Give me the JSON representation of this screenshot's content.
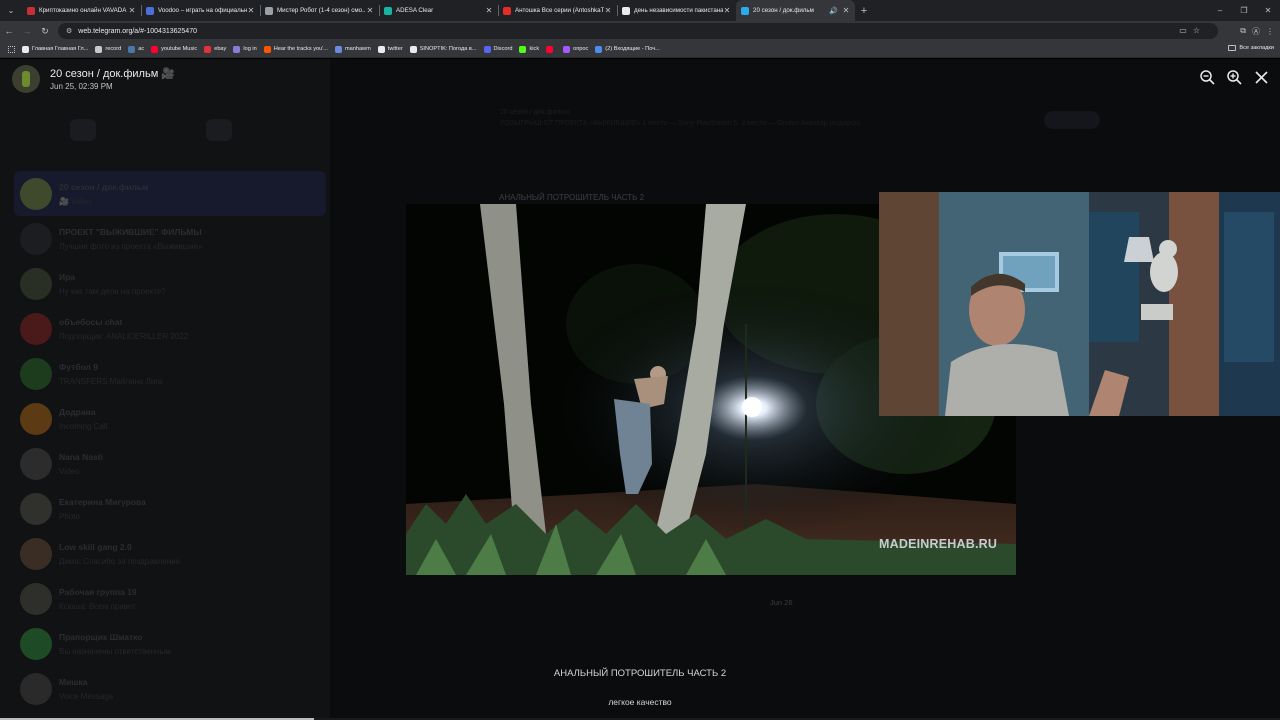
{
  "browser": {
    "tabs": [
      {
        "title": "Криптоказино онлайн VAVADA",
        "favicon_color": "#c62f3a",
        "active": false
      },
      {
        "title": "Voodoo – играть на официальн...",
        "favicon_color": "#4a6fd6",
        "active": false
      },
      {
        "title": "Мистер Робот (1-4 сезон) смо...",
        "favicon_color": "#9aa0a6",
        "active": false
      },
      {
        "title": "ADESA Clear",
        "favicon_color": "#17b3a3",
        "active": false
      },
      {
        "title": "Антошка Все серии (AntoshkaTV)",
        "favicon_color": "#e52d27",
        "active": false
      },
      {
        "title": "день независимости пакистана",
        "favicon_color": "#e8eaed",
        "active": false
      },
      {
        "title": "20 сезон / док.фильм",
        "favicon_color": "#2aabee",
        "active": true
      }
    ],
    "url": "web.telegram.org/a/#-1004313625470",
    "bookmarks": [
      {
        "label": "Главная Главная Гл...",
        "color": "#e8eaed"
      },
      {
        "label": "record",
        "color": "#c9c9c9"
      },
      {
        "label": "ac",
        "color": "#4a76a8"
      },
      {
        "label": "youtube Music",
        "color": "#ff0033"
      },
      {
        "label": "ebay",
        "color": "#e53238"
      },
      {
        "label": "log in",
        "color": "#8a7bd6"
      },
      {
        "label": "Hear the tracks you'...",
        "color": "#ff5500"
      },
      {
        "label": "manhawm",
        "color": "#6a8be0"
      },
      {
        "label": "twitter",
        "color": "#e8eaed"
      },
      {
        "label": "SINOPTIK: Погода в...",
        "color": "#e8eaed"
      },
      {
        "label": "Discord",
        "color": "#5865f2"
      },
      {
        "label": "kick",
        "color": "#53fc18"
      },
      {
        "label": "",
        "color": "#ff0033"
      },
      {
        "label": "опрос",
        "color": "#a259ff"
      },
      {
        "label": "(2) Входящие - Поч...",
        "color": "#4a8ff0"
      }
    ],
    "all_bookmarks": "Все закладки"
  },
  "viewer": {
    "title": "20 сезон / док.фильм 🎥",
    "date": "Jun 25, 02:39 PM",
    "watermark": "MADEINREHAB.RU",
    "caption": "АНАЛЬНЫЙ ПОТРОШИТЕЛЬ ЧАСТЬ 2",
    "subcaption": "легкое качество",
    "progress": 0.245
  },
  "underlay": {
    "pinned_title": "20 сезон / док.фильм",
    "pinned_text": "РОЗЫГРЫШ ОТ ПРОЕКТА «ВЫЖИВШИЕ» 1 место — Sony PlayStation 5, 2 место — Oculus Аквахар (подарок)",
    "day": "Jun 26",
    "video_caption": "АНАЛЬНЫЙ ПОТРОШИТЕЛЬ ЧАСТЬ 2",
    "chats": [
      {
        "name": "20 сезон / док.фильм",
        "preview": "🎥 Video",
        "color": "#3f4a2c",
        "active": true
      },
      {
        "name": "ПРОЕКТ \"ВЫЖИВШИЕ\" ФИЛЬМЫ",
        "preview": "Лучшие фото из проекта «Выжившие»",
        "color": "#1c1d20",
        "active": false
      },
      {
        "name": "Ира",
        "preview": "Ну как там дела на проекте?",
        "color": "#2a2f26",
        "active": false
      },
      {
        "name": "объебосы chat",
        "preview": "Подпорщик: ANALIDERILLER 2022",
        "color": "#4a1a1a",
        "active": false
      },
      {
        "name": "Футбол 9",
        "preview": "TRANSFERS Майлина Лига",
        "color": "#1d3b1d",
        "active": false
      },
      {
        "name": "Додрана",
        "preview": "Incoming Call",
        "color": "#5b3a14",
        "active": false
      },
      {
        "name": "Nana Nasti",
        "preview": "Video",
        "color": "#2c2c2c",
        "active": false
      },
      {
        "name": "Екатерина Мигурова",
        "preview": "Photo",
        "color": "#30302c",
        "active": false
      },
      {
        "name": "Low skill gang 2.0",
        "preview": "Дима: Спасибо за поздравление",
        "color": "#3a2e24",
        "active": false
      },
      {
        "name": "Рабочая группа 19",
        "preview": "Ксюша: Всем привет",
        "color": "#2e2e2a",
        "active": false
      },
      {
        "name": "Прапорщик Шматко",
        "preview": "Вы назначены ответственным",
        "color": "#1e4a26",
        "active": false
      },
      {
        "name": "Мишка",
        "preview": "Voice Message",
        "color": "#2a2a2a",
        "active": false
      }
    ]
  }
}
